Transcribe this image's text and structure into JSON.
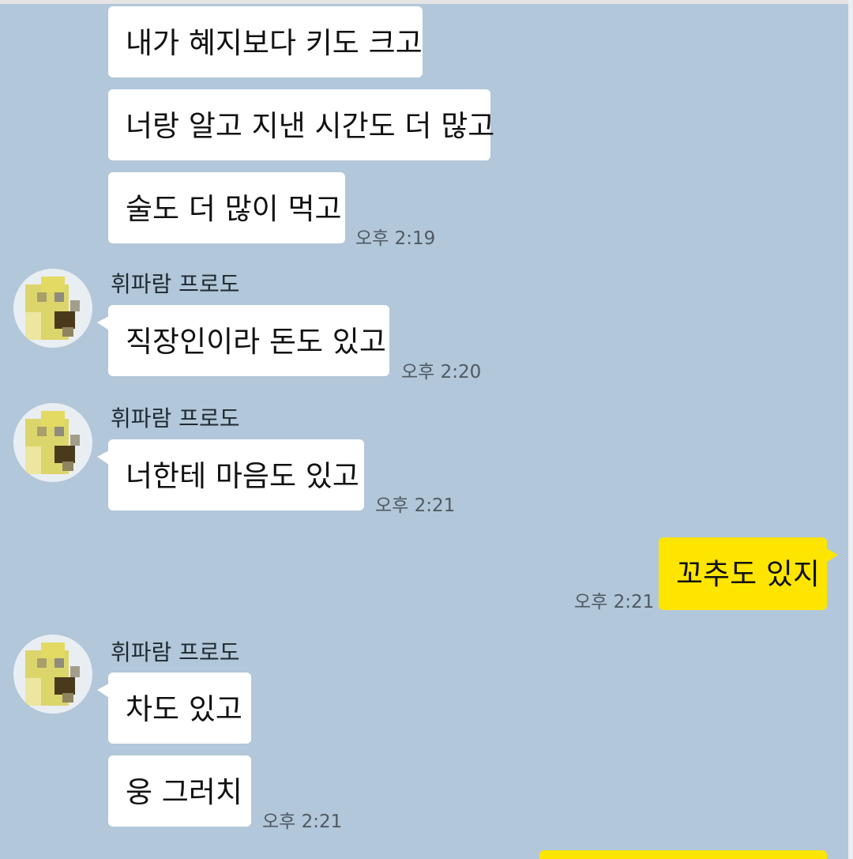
{
  "colors": {
    "chat_background": "#b2c7d9",
    "incoming_bubble": "#ffffff",
    "outgoing_bubble": "#fee500",
    "timestamp_text": "#4e5a63"
  },
  "messages": [
    {
      "text": "내가 혜지보다 키도 크고",
      "from": "me",
      "time": ""
    },
    {
      "text": "너랑 알고 지낸 시간도 더 많고",
      "from": "me",
      "time": ""
    },
    {
      "text": "술도 더 많이 먹고",
      "from": "me",
      "time": "오후 2:19"
    },
    {
      "sender": "휘파람 프로도",
      "text": "직장인이라 돈도 있고",
      "time": "오후 2:20"
    },
    {
      "sender": "휘파람 프로도",
      "text": "너한테 마음도 있고",
      "time": "오후 2:21"
    },
    {
      "text": "꼬추도 있지",
      "from": "self",
      "time": "오후 2:21"
    },
    {
      "sender": "휘파람 프로도",
      "text": "차도 있고",
      "time": ""
    },
    {
      "text": "웅 그러치",
      "time": "오후 2:21"
    }
  ],
  "avatar_icon": "pixelated-yellow-avatar-icon"
}
